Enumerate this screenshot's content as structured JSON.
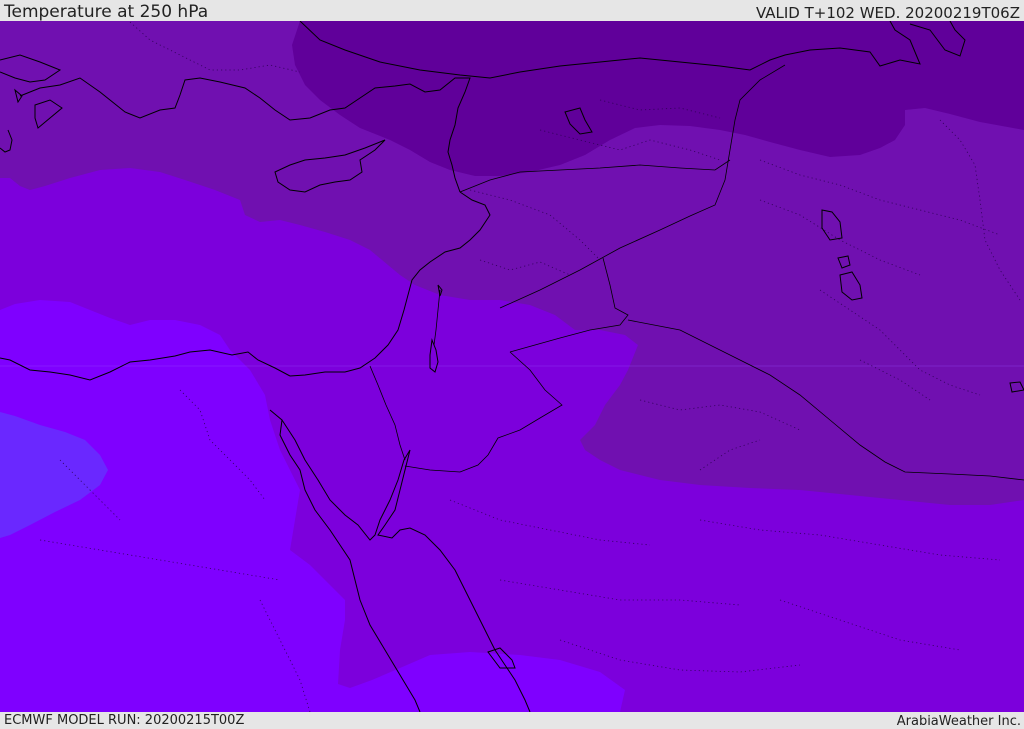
{
  "header": {
    "title": "Temperature at 250 hPa",
    "valid": "VALID T+102 WED. 20200219T06Z"
  },
  "footer": {
    "model_run": "ECMWF MODEL RUN: 20200215T00Z",
    "credit": "ArabiaWeather Inc."
  },
  "map": {
    "colors": {
      "coldest": "#60009a",
      "cold": "#7010b0",
      "mid": "#7c00dc",
      "warm": "#7f00ff",
      "warmest": "#6a28ff"
    }
  }
}
